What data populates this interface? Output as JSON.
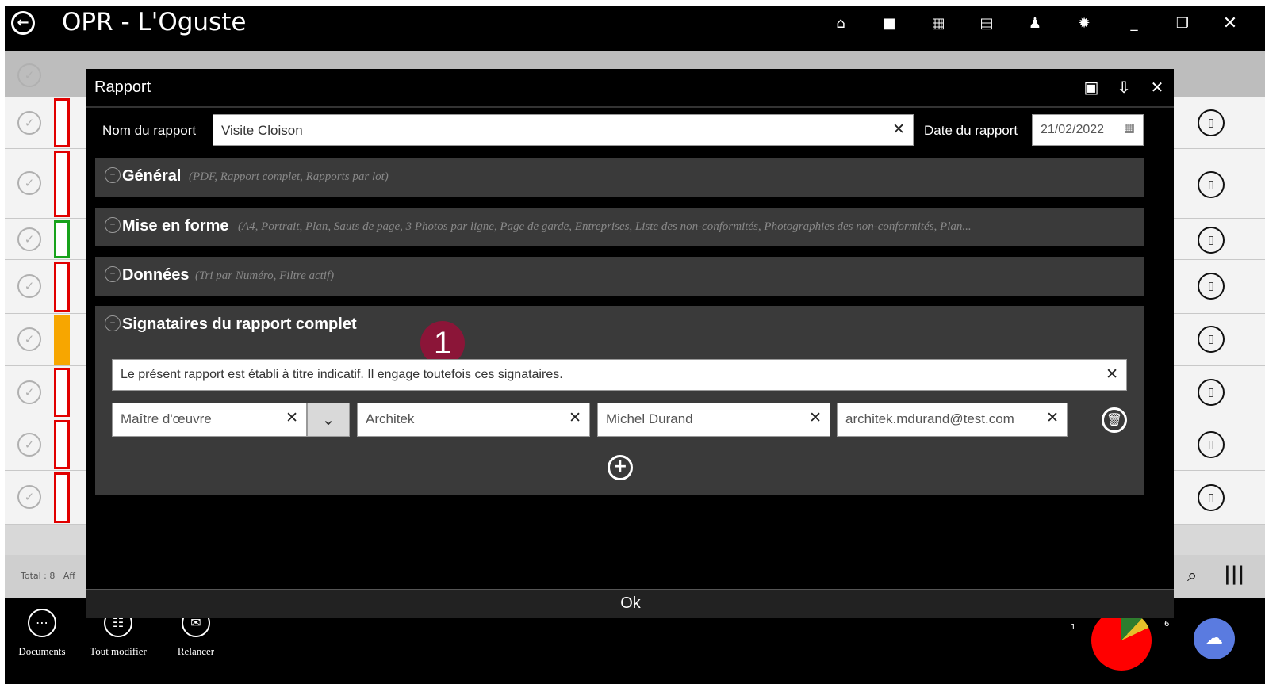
{
  "app": {
    "title": "OPR - L'Oguste",
    "back_icon": "back-arrow-icon"
  },
  "toolbar": {
    "icons": [
      "home-icon",
      "folder-icon",
      "grid-icon",
      "calendar-icon",
      "user-icon",
      "gear-icon",
      "minimize-icon",
      "restore-icon",
      "close-icon"
    ]
  },
  "list": {
    "total_text": "Total : 8",
    "aff_text": "Aff"
  },
  "bottom_bar": {
    "documents_label": "Documents",
    "tout_modifier_label": "Tout modifier",
    "relancer_label": "Relancer",
    "pie_label_left": "1",
    "pie_label_right": "6"
  },
  "modal": {
    "title": "Rapport",
    "nom_label": "Nom du rapport",
    "nom_value": "Visite Cloison",
    "date_label": "Date du rapport",
    "date_value": "21/02/2022",
    "sections": {
      "general": {
        "title": "Général",
        "subtitle": "(PDF, Rapport complet, Rapports par lot)"
      },
      "mise_en_forme": {
        "title": "Mise en forme",
        "subtitle": "(A4, Portrait, Plan, Sauts de page, 3 Photos par ligne, Page de garde, Entreprises, Liste des non-conformités, Photographies des non-conformités, Plan..."
      },
      "donnees": {
        "title": "Données",
        "subtitle": "(Tri par Numéro, Filtre actif)"
      },
      "signataires": {
        "title": "Signataires du rapport complet"
      }
    },
    "signataires": {
      "disclaimer": "Le présent rapport est établi à titre indicatif. Il engage toutefois ces signataires.",
      "role": "Maître d'œuvre",
      "company": "Architek",
      "name": "Michel Durand",
      "email": "architek.mdurand@test.com"
    },
    "badge_number": "1",
    "ok_label": "Ok"
  },
  "colors": {
    "badge": "#8b1538",
    "flag_red": "#e10000",
    "flag_green": "#17a21b",
    "flag_orange": "#f7a600"
  }
}
